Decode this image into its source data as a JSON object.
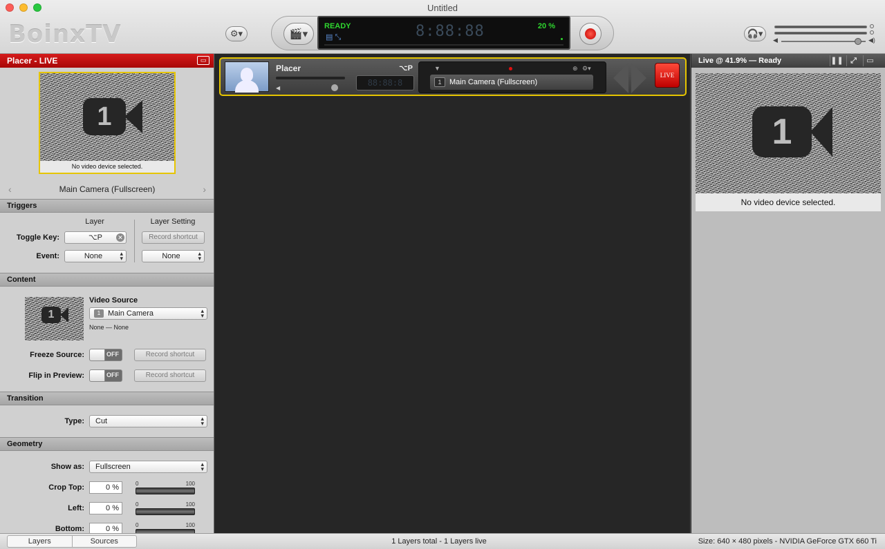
{
  "window": {
    "title": "Untitled"
  },
  "toolbar": {
    "logo": "BoinxTV",
    "status": "READY",
    "time": "8:88:88",
    "percent": "20 %"
  },
  "left_panel": {
    "header": "Placer - LIVE",
    "preview_message": "No video device selected.",
    "camera_number": "1",
    "current_source": "Main Camera (Fullscreen)",
    "triggers": {
      "title": "Triggers",
      "col_layer": "Layer",
      "col_layer_setting": "Layer Setting",
      "toggle_key_label": "Toggle Key:",
      "toggle_key_value": "⌥P",
      "record_shortcut": "Record shortcut",
      "event_label": "Event:",
      "event_value": "None",
      "event_setting_value": "None"
    },
    "content": {
      "title": "Content",
      "video_source_label": "Video Source",
      "video_source_value": "Main Camera",
      "video_source_sub": "None — None",
      "freeze_label": "Freeze Source:",
      "flip_label": "Flip in Preview:",
      "toggle_off": "OFF",
      "record_shortcut": "Record shortcut"
    },
    "transition": {
      "title": "Transition",
      "type_label": "Type:",
      "type_value": "Cut"
    },
    "geometry": {
      "title": "Geometry",
      "show_as_label": "Show as:",
      "show_as_value": "Fullscreen",
      "slider_min": "0",
      "slider_max": "100",
      "rows": [
        {
          "label": "Crop Top:",
          "value": "0 %"
        },
        {
          "label": "Left:",
          "value": "0 %"
        },
        {
          "label": "Bottom:",
          "value": "0 %"
        }
      ]
    }
  },
  "layer": {
    "name": "Placer",
    "shortcut": "⌥P",
    "time": "88:88:8",
    "source": "Main Camera (Fullscreen)",
    "source_number": "1",
    "live_label": "LIVE"
  },
  "right_panel": {
    "header": "Live @ 41.9% — Ready",
    "preview_message": "No video device selected.",
    "camera_number": "1"
  },
  "statusbar": {
    "tabs": [
      "Layers",
      "Sources"
    ],
    "center": "1 Layers total - 1 Layers live",
    "right": "Size: 640 × 480 pixels - NVIDIA GeForce GTX 660 Ti"
  }
}
